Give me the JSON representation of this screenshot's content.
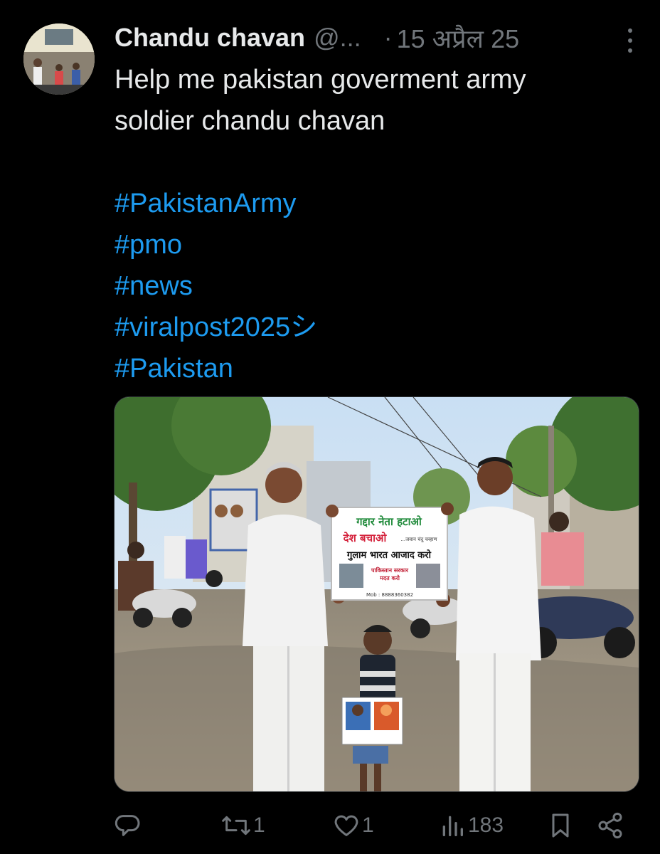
{
  "tweet": {
    "author_name": "Chandu chavan",
    "author_handle": "@...",
    "separator": "·",
    "date": "15 अप्रैल 25",
    "text_line1": "Help me pakistan goverment army",
    "text_line2": "soldier chandu chavan",
    "hashtags": [
      "#PakistanArmy",
      "#pmo",
      "#news",
      "#viralpost2025シ",
      "#Pakistan"
    ]
  },
  "photo": {
    "banner_line1": "गद्दार नेता हटाओ",
    "banner_line2": "देश बचाओ",
    "banner_small": "...जवान चंदु चव्हाण",
    "banner_line3": "गुलाम भारत आजाद करो",
    "banner_line4": "पाकिस्तान सरकार",
    "banner_line5": "मदत करो",
    "banner_contact": "Mob : 8888360382"
  },
  "actions": {
    "reply_count": "",
    "retweet_count": "1",
    "like_count": "1",
    "views_count": "183"
  },
  "colors": {
    "background": "#000000",
    "text": "#e7e9ea",
    "muted": "#71767b",
    "link": "#1d9bf0"
  },
  "icons": [
    "reply-icon",
    "retweet-icon",
    "like-icon",
    "views-icon",
    "bookmark-icon",
    "share-icon",
    "more-icon"
  ]
}
